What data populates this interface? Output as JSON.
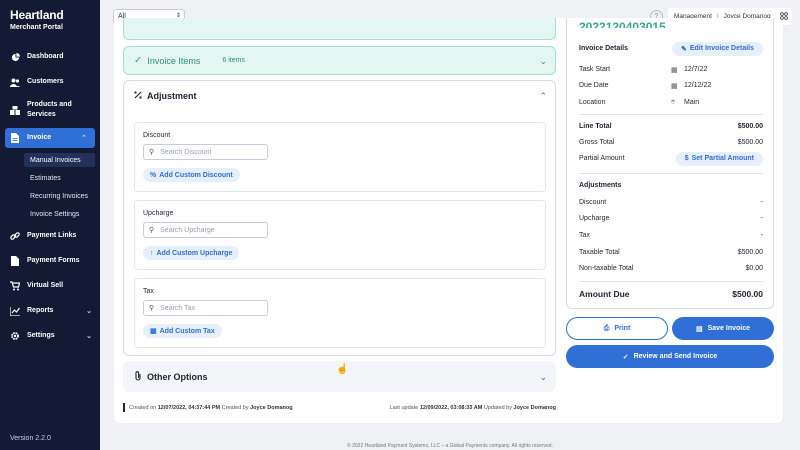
{
  "brand": {
    "title": "Heartland",
    "subtitle": "Merchant Portal"
  },
  "sidebar": {
    "items": [
      {
        "label": "Dashboard",
        "icon": "dashboard-icon"
      },
      {
        "label": "Customers",
        "icon": "users-icon"
      },
      {
        "label": "Products and Services",
        "icon": "boxes-icon"
      },
      {
        "label": "Invoice",
        "icon": "invoice-icon",
        "active": true
      },
      {
        "label": "Payment Links",
        "icon": "link-icon"
      },
      {
        "label": "Payment Forms",
        "icon": "form-icon"
      },
      {
        "label": "Virtual Sell",
        "icon": "cart-icon"
      },
      {
        "label": "Reports",
        "icon": "chart-icon"
      },
      {
        "label": "Settings",
        "icon": "gear-icon"
      }
    ],
    "invoice_sub": [
      {
        "label": "Manual Invoices",
        "active": true
      },
      {
        "label": "Estimates"
      },
      {
        "label": "Recurring Invoices"
      },
      {
        "label": "Invoice Settings"
      }
    ],
    "version": "Version 2.2.0"
  },
  "topbar": {
    "filter_value": "All",
    "help_glyph": "?",
    "role": "Management",
    "separator": "|",
    "user": "Joyce Domanog"
  },
  "invoice_items": {
    "title": "Invoice Items",
    "count": "6 items"
  },
  "adjustment": {
    "title": "Adjustment",
    "discount": {
      "label": "Discount",
      "placeholder": "Search Discount",
      "button": "Add Custom Discount"
    },
    "upcharge": {
      "label": "Upcharge",
      "placeholder": "Search Upcharge",
      "button": "Add Custom Upcharge"
    },
    "tax": {
      "label": "Tax",
      "placeholder": "Search Tax",
      "button": "Add Custom Tax"
    }
  },
  "other_options": {
    "title": "Other Options"
  },
  "footer_meta": {
    "created_prefix": "Created on",
    "created_date": "12/07/2022, 04:37:44 PM",
    "created_by_prefix": "Created by",
    "created_by": "Joyce Domanog",
    "updated_prefix": "Last update",
    "updated_date": "12/09/2022, 03:08:33 AM",
    "updated_by_prefix": "Updated by",
    "updated_by": "Joyce Domanog"
  },
  "summary": {
    "invoice_number_partial": "2022120403015",
    "invoice_details_label": "Invoice Details",
    "edit_details_button": "Edit Invoice Details",
    "task_start_label": "Task Start",
    "task_start_value": "12/7/22",
    "due_date_label": "Due Date",
    "due_date_value": "12/12/22",
    "location_label": "Location",
    "location_value": "Main",
    "line_total_label": "Line Total",
    "line_total_value": "$500.00",
    "gross_total_label": "Gross Total",
    "gross_total_value": "$500.00",
    "partial_amount_label": "Partial Amount",
    "partial_amount_button": "Set Partial Amount",
    "adjustments_label": "Adjustments",
    "discount_label": "Discount",
    "discount_value": "-",
    "upcharge_label": "Upcharge",
    "upcharge_value": "-",
    "tax_label": "Tax",
    "tax_value": "-",
    "taxable_label": "Taxable Total",
    "taxable_value": "$500.00",
    "nontaxable_label": "Non-taxable Total",
    "nontaxable_value": "$0.00",
    "amount_due_label": "Amount Due",
    "amount_due_value": "$500.00"
  },
  "actions": {
    "print": "Print",
    "save": "Save Invoice",
    "review": "Review and Send Invoice"
  },
  "copyright": "© 2022 Heartland Payment Systems, LLC – a Global Payments company. All rights reserved.",
  "colors": {
    "sidebar_bg": "#141a33",
    "accent": "#2f6fd6",
    "success": "#37a98a"
  }
}
